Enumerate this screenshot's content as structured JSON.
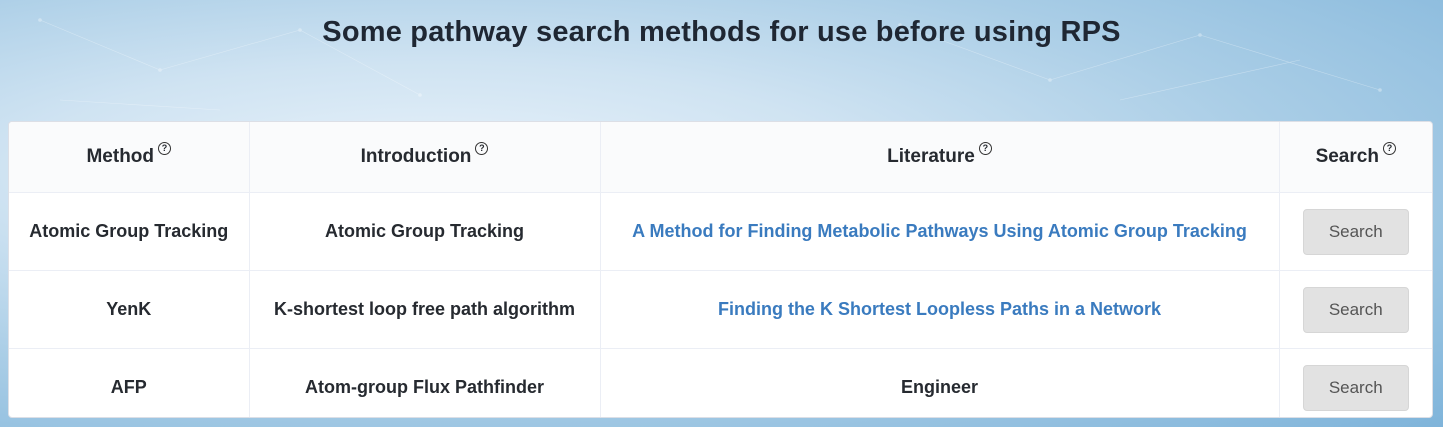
{
  "page": {
    "title": "Some pathway search methods for use before using RPS"
  },
  "table": {
    "headers": [
      "Method",
      "Introduction",
      "Literature",
      "Search"
    ],
    "help_glyph": "?",
    "rows": [
      {
        "method": "Atomic Group Tracking",
        "introduction": "Atomic Group Tracking",
        "literature": "A Method for Finding Metabolic Pathways Using Atomic Group Tracking",
        "search_label": "Search"
      },
      {
        "method": "YenK",
        "introduction": "K-shortest loop free path algorithm",
        "literature": "Finding the K Shortest Loopless Paths in a Network",
        "search_label": "Search"
      },
      {
        "method": "AFP",
        "introduction": "Atom-group Flux Pathfinder",
        "literature": "Engineer",
        "search_label": "Search"
      }
    ]
  },
  "colors": {
    "link": "#3a7bbf",
    "button_bg": "#e2e2e2",
    "title_text": "#1f2733"
  }
}
